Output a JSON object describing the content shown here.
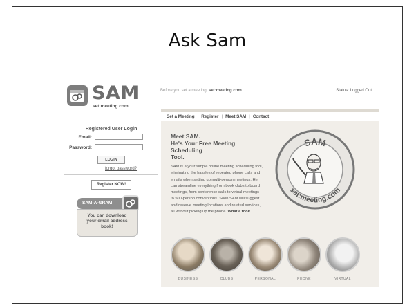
{
  "slide": {
    "title": "Ask Sam"
  },
  "header": {
    "logo_word": "SAM",
    "logo_sub": "set:meeting.com",
    "tagline_prefix": "Before you set a meeting,",
    "tagline_brand": "set:meeting.com",
    "status": "Status: Logged Out"
  },
  "nav": {
    "items": [
      "Set a Meeting",
      "Register",
      "Meet SAM",
      "Contact"
    ],
    "separator": "|"
  },
  "login": {
    "title": "Registered User Login",
    "email_label": "Email:",
    "password_label": "Password:",
    "login_button": "LOGIN",
    "forgot_link": "forgot password?",
    "register_button": "Register NOW!"
  },
  "samagram": {
    "tab_label": "SAM-A-GRAM",
    "line1": "You can download",
    "line2": "your email address",
    "line3": "book!"
  },
  "main": {
    "headline1": "Meet SAM.",
    "headline2": "He's Your Free Meeting Scheduling",
    "headline3": "Tool.",
    "body": "SAM is a your simple online meeting scheduling tool, eliminating the hassles of repeated phone calls and emails when setting up multi-person meetings. He can streamline everything from book clubs to board meetings, from conference calls to virtual meetings to 500-person conventions. Soon SAM will suggest and reserve meeting locations and related services, all without picking up the phone.",
    "body_bold": "What a tool!"
  },
  "mascot": {
    "top_text": "SAM",
    "bottom_text": "set:meeting.com"
  },
  "categories": [
    "BUSINESS",
    "CLUBS",
    "PERSONAL",
    "PHONE",
    "VIRTUAL"
  ],
  "colors": {
    "panel_bg": "#f1eee9",
    "logo_gray": "#6c6c6c",
    "nav_rule": "#dedad2"
  }
}
